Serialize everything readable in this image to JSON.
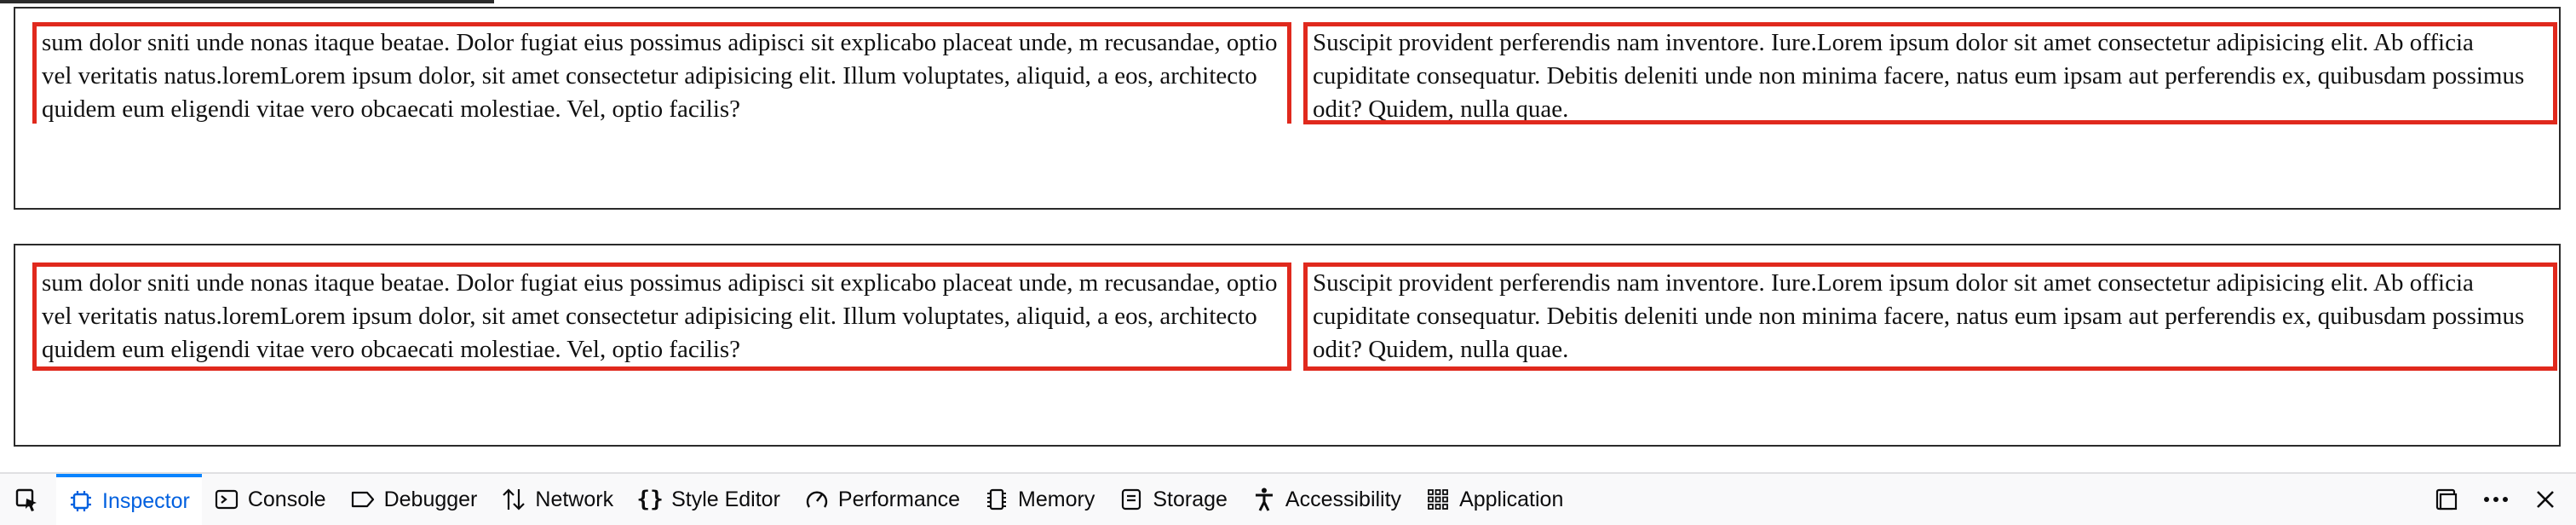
{
  "content": {
    "left_text": "sum dolor sniti unde nonas itaque beatae. Dolor fugiat eius possimus adipisci sit explicabo placeat unde, m recusandae, optio vel veritatis natus.loremLorem ipsum dolor, sit amet consectetur adipisicing elit. Illum voluptates, aliquid, a eos, architecto quidem eum eligendi vitae vero obcaecati molestiae. Vel, optio facilis?",
    "right_text": "Suscipit provident perferendis nam inventore. Iure.Lorem ipsum dolor sit amet consectetur adipisicing elit. Ab officia cupiditate consequatur. Debitis deleniti unde non minima facere, natus eum ipsam aut perferendis ex, quibusdam possimus odit? Quidem, nulla quae."
  },
  "devtools": {
    "tabs": [
      {
        "label": "Inspector",
        "icon": "inspector-icon",
        "active": true
      },
      {
        "label": "Console",
        "icon": "console-icon"
      },
      {
        "label": "Debugger",
        "icon": "debugger-icon"
      },
      {
        "label": "Network",
        "icon": "network-icon"
      },
      {
        "label": "Style Editor",
        "icon": "style-editor-icon"
      },
      {
        "label": "Performance",
        "icon": "performance-icon"
      },
      {
        "label": "Memory",
        "icon": "memory-icon"
      },
      {
        "label": "Storage",
        "icon": "storage-icon"
      },
      {
        "label": "Accessibility",
        "icon": "accessibility-icon"
      },
      {
        "label": "Application",
        "icon": "application-icon"
      }
    ],
    "colors": {
      "active": "#0060df",
      "active_border": "#0a84ff",
      "highlight": "#e0291d"
    }
  }
}
